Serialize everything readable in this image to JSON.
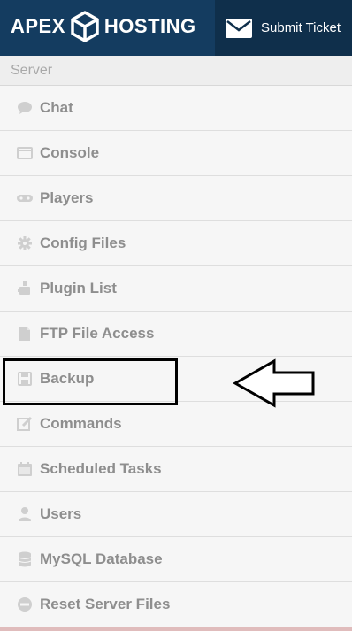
{
  "header": {
    "logo_left": "APEX",
    "logo_right": "HOSTING",
    "submit_ticket": "Submit Ticket"
  },
  "sidebar": {
    "section_title": "Server",
    "items": [
      {
        "label": "Chat",
        "icon": "chat-icon"
      },
      {
        "label": "Console",
        "icon": "console-icon"
      },
      {
        "label": "Players",
        "icon": "players-icon"
      },
      {
        "label": "Config Files",
        "icon": "gear-icon"
      },
      {
        "label": "Plugin List",
        "icon": "plugin-icon"
      },
      {
        "label": "FTP File Access",
        "icon": "file-icon"
      },
      {
        "label": "Backup",
        "icon": "save-icon"
      },
      {
        "label": "Commands",
        "icon": "edit-icon"
      },
      {
        "label": "Scheduled Tasks",
        "icon": "calendar-icon"
      },
      {
        "label": "Users",
        "icon": "user-icon"
      },
      {
        "label": "MySQL Database",
        "icon": "database-icon"
      },
      {
        "label": "Reset Server Files",
        "icon": "reset-icon"
      }
    ]
  },
  "annotation": {
    "highlighted_item": "Backup"
  },
  "colors": {
    "header_bg": "#143c60",
    "ticket_bg": "#0f2f4b",
    "menu_bg": "#f6f6f6",
    "menu_text": "#8e8e8e",
    "annotation": "#000000"
  }
}
